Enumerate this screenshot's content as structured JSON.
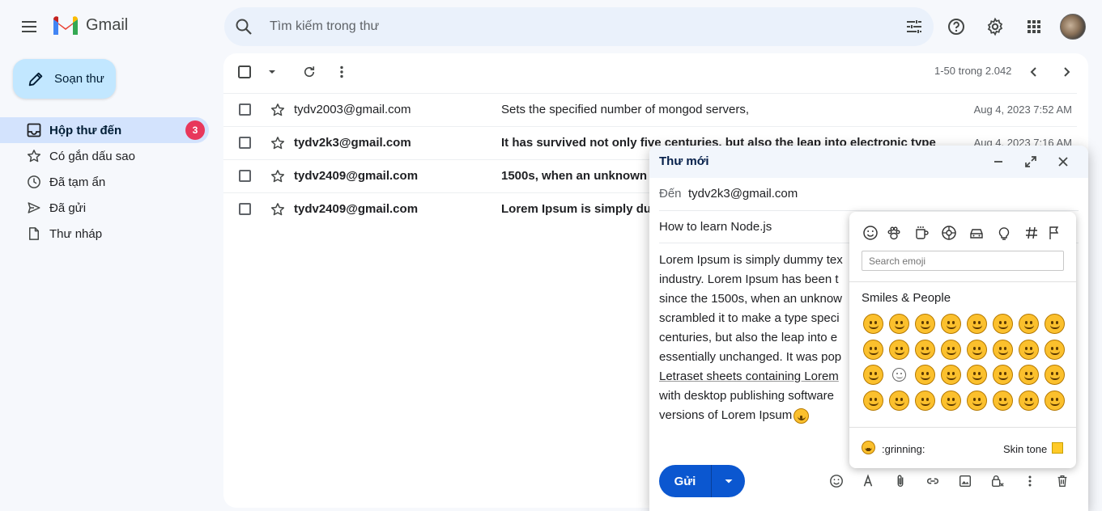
{
  "header": {
    "logo_text": "Gmail",
    "search_placeholder": "Tìm kiếm trong thư"
  },
  "sidebar": {
    "compose_label": "Soạn thư",
    "items": [
      {
        "label": "Hộp thư đến",
        "icon": "inbox-icon",
        "badge": "3",
        "active": true
      },
      {
        "label": "Có gắn dấu sao",
        "icon": "star-icon"
      },
      {
        "label": "Đã tạm ẩn",
        "icon": "clock-icon"
      },
      {
        "label": "Đã gửi",
        "icon": "send-icon"
      },
      {
        "label": "Thư nháp",
        "icon": "draft-icon"
      }
    ]
  },
  "toolbar": {
    "pager": "1-50 trong 2.042"
  },
  "emails": [
    {
      "sender": "tydv2003@gmail.com",
      "subject": "Sets the specified number of mongod servers,",
      "date": "Aug 4, 2023 7:52 AM",
      "unread": false
    },
    {
      "sender": "tydv2k3@gmail.com",
      "subject": "It has survived not only five centuries, but also the leap into electronic type",
      "date": "Aug 4, 2023 7:16 AM",
      "unread": true
    },
    {
      "sender": "tydv2409@gmail.com",
      "subject": "1500s, when an unknown",
      "date": "",
      "unread": true
    },
    {
      "sender": "tydv2409@gmail.com",
      "subject": "Lorem Ipsum is simply du",
      "date": "",
      "unread": true
    }
  ],
  "compose": {
    "title": "Thư mới",
    "to_label": "Đến",
    "to_value": "tydv2k3@gmail.com",
    "subject": "How to learn Node.js",
    "body_lines": [
      "Lorem Ipsum is simply dummy tex",
      "industry. Lorem Ipsum has been t",
      "since the 1500s, when an unknow",
      "scrambled it to make a type speci",
      "centuries, but also the leap into e",
      "essentially unchanged. It was pop",
      "Letraset sheets containing Lorem",
      "with desktop publishing software",
      "versions of Lorem Ipsum"
    ],
    "send_label": "Gửi"
  },
  "emoji_picker": {
    "categories": [
      "smiley-icon",
      "paw-icon",
      "mug-icon",
      "ball-icon",
      "car-icon",
      "bulb-icon",
      "hash-icon",
      "flag-icon"
    ],
    "search_placeholder": "Search emoji",
    "category_title": "Smiles & People",
    "preview_name": ":grinning:",
    "skin_tone_label": "Skin tone",
    "skin_tone_color": "#ffca28",
    "emoji_count": 40
  },
  "colors": {
    "accent": "#0b57d0",
    "compose_bg": "#c2e7ff",
    "nav_active": "#d3e3fd",
    "badge": "#e8385b"
  }
}
